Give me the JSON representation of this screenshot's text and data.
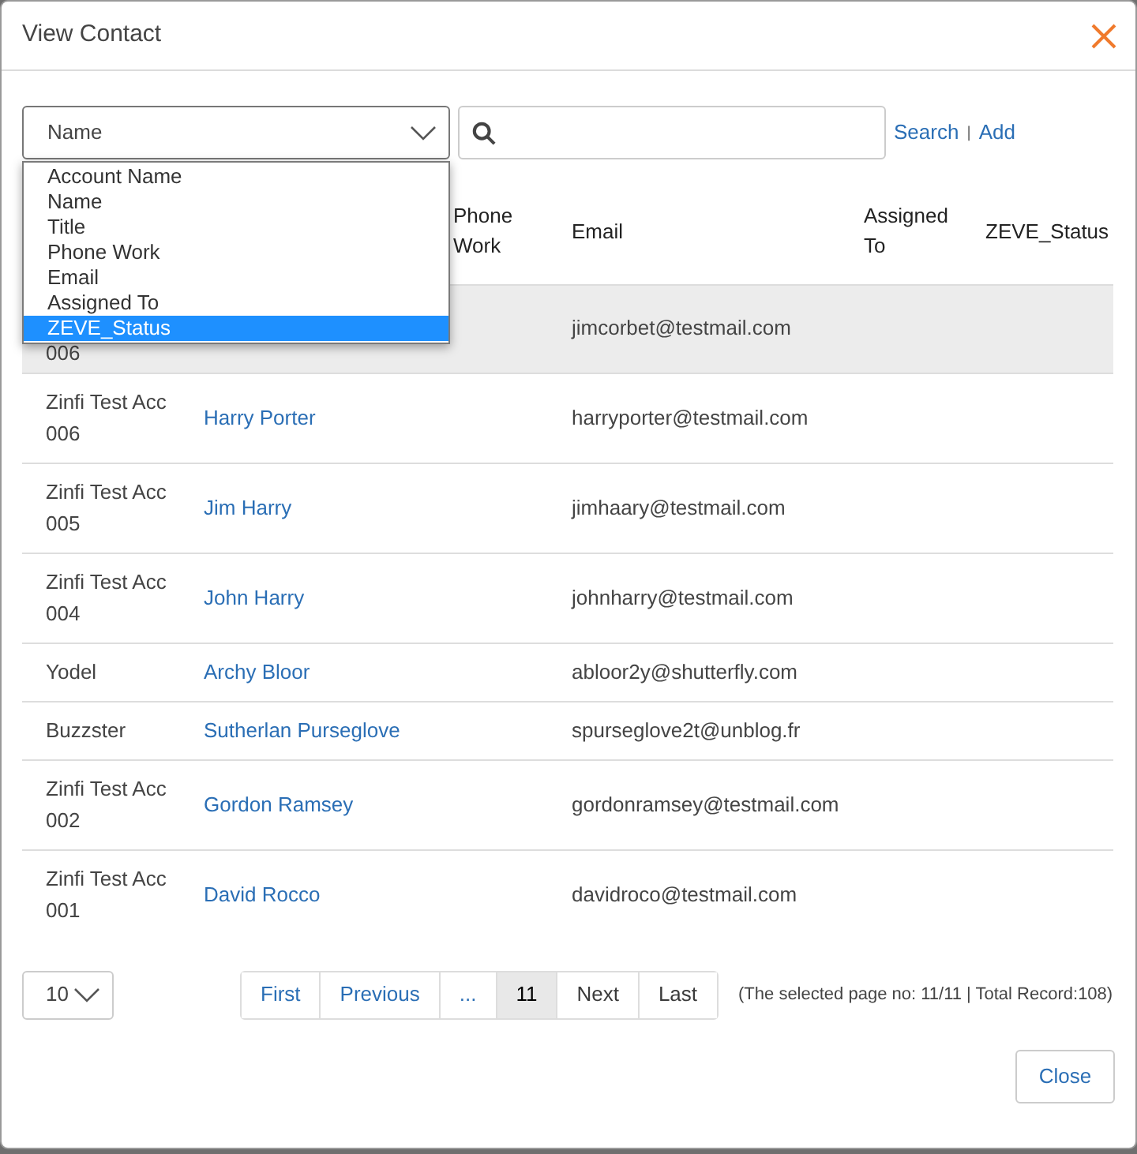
{
  "dialog": {
    "title": "View Contact"
  },
  "filter": {
    "field_select": {
      "value": "Name",
      "expanded": true
    },
    "links": [
      {
        "label": "Search"
      },
      {
        "label": "Add"
      }
    ],
    "link_separator": "|"
  },
  "field_options": [
    {
      "label": "Account Name",
      "selected": false
    },
    {
      "label": "Name",
      "selected": false
    },
    {
      "label": "Title",
      "selected": false
    },
    {
      "label": "Phone Work",
      "selected": false
    },
    {
      "label": "Email",
      "selected": false
    },
    {
      "label": "Assigned To",
      "selected": false
    },
    {
      "label": "ZEVE_Status",
      "selected": true
    }
  ],
  "table": {
    "columns": [
      {
        "label": "Phone Work"
      },
      {
        "label": "Email"
      },
      {
        "label": "Assigned To"
      },
      {
        "label": "ZEVE_Status"
      }
    ],
    "rows": [
      {
        "account_name": "006",
        "email": "jimcorbet@testmail.com",
        "highlighted": true,
        "covered_by_menu": true
      },
      {
        "account_name": "Zinfi Test Acc 006",
        "name": "Harry Porter",
        "email": "harryporter@testmail.com",
        "highlighted": false,
        "covered_by_menu": false
      },
      {
        "account_name": "Zinfi Test Acc 005",
        "name": "Jim Harry",
        "email": "jimhaary@testmail.com",
        "highlighted": false,
        "covered_by_menu": false
      },
      {
        "account_name": "Zinfi Test Acc 004",
        "name": "John Harry",
        "email": "johnharry@testmail.com",
        "highlighted": false,
        "covered_by_menu": false
      },
      {
        "account_name": "Yodel",
        "name": "Archy Bloor",
        "email": "abloor2y@shutterfly.com",
        "highlighted": false,
        "covered_by_menu": false
      },
      {
        "account_name": "Buzzster",
        "name": "Sutherlan Purseglove",
        "email": "spurseglove2t@unblog.fr",
        "highlighted": false,
        "covered_by_menu": false
      },
      {
        "account_name": "Zinfi Test Acc 002",
        "name": "Gordon Ramsey",
        "email": "gordonramsey@testmail.com",
        "highlighted": false,
        "covered_by_menu": false
      },
      {
        "account_name": "Zinfi Test Acc 001",
        "name": "David Rocco",
        "email": "davidroco@testmail.com",
        "highlighted": false,
        "covered_by_menu": false
      }
    ]
  },
  "pagination": {
    "page_size": "10",
    "pages": [
      {
        "label": "First",
        "selected": false,
        "disabled": false
      },
      {
        "label": "Previous",
        "selected": false,
        "disabled": false
      },
      {
        "label": "...",
        "selected": false,
        "disabled": false
      },
      {
        "label": "11",
        "selected": true,
        "disabled": false
      },
      {
        "label": "Next",
        "selected": false,
        "disabled": true
      },
      {
        "label": "Last",
        "selected": false,
        "disabled": true
      }
    ],
    "info": "(The selected page no: 11/11 | Total Record:108)"
  },
  "footer": {
    "close_button": "Close"
  }
}
